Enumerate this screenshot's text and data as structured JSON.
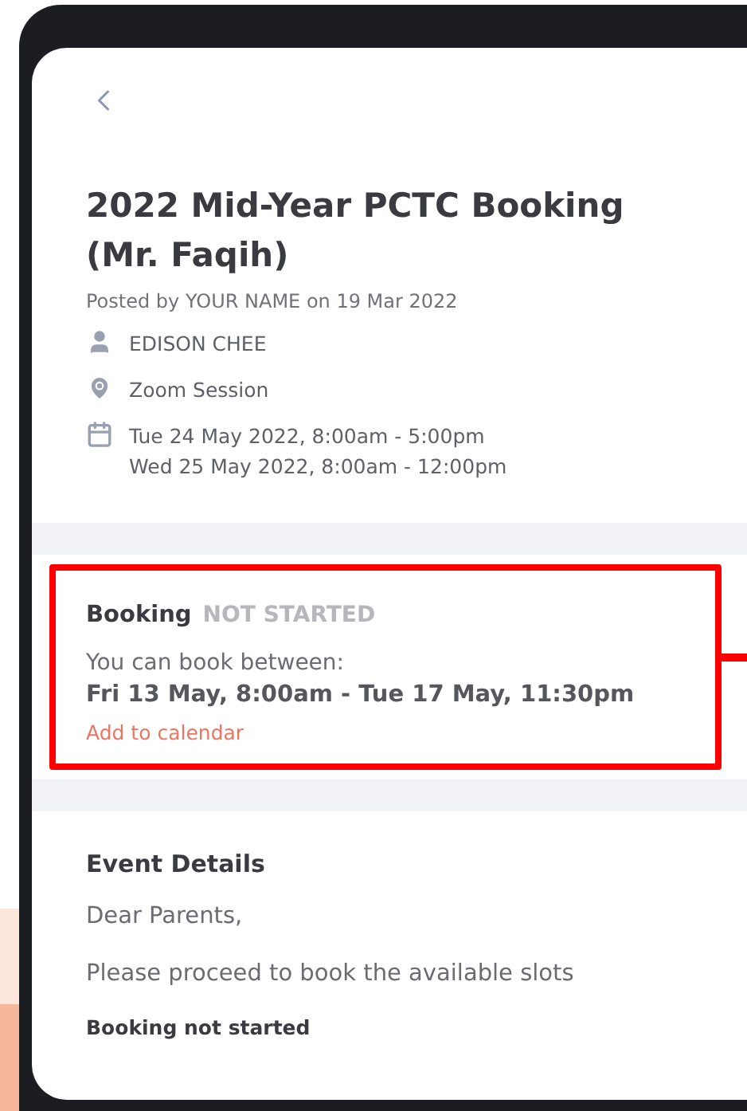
{
  "event": {
    "title": "2022 Mid-Year PCTC Booking (Mr. Faqih)",
    "posted_by": "Posted by YOUR NAME on 19 Mar 2022",
    "details": [
      {
        "kind": "person",
        "lines": [
          "EDISON CHEE"
        ]
      },
      {
        "kind": "location",
        "lines": [
          "Zoom Session"
        ]
      },
      {
        "kind": "calendar",
        "lines": [
          "Tue 24 May 2022, 8:00am - 5:00pm",
          "Wed 25 May 2022, 8:00am - 12:00pm"
        ]
      }
    ]
  },
  "booking": {
    "label": "Booking",
    "status": "NOT STARTED",
    "intro": "You can book between:",
    "range": "Fri 13 May, 8:00am - Tue 17 May, 11:30pm",
    "link": "Add to calendar",
    "highlighted": true
  },
  "event_details": {
    "heading": "Event Details",
    "paragraphs": [
      "Dear Parents,",
      "Please proceed to book the available slots"
    ],
    "footer": "Booking not started"
  }
}
